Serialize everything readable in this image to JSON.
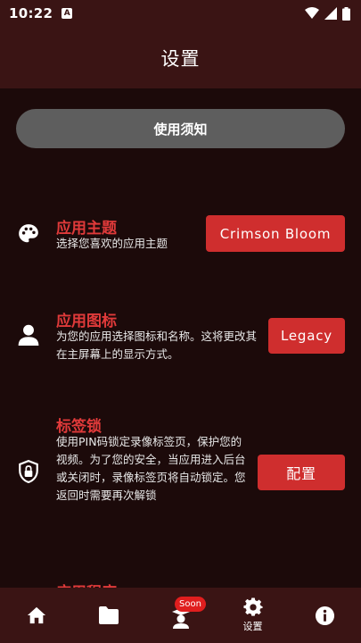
{
  "status": {
    "time": "10:22",
    "badge": "A"
  },
  "appbar": {
    "title": "设置"
  },
  "notice": {
    "label": "使用须知"
  },
  "settings": [
    {
      "title": "应用主题",
      "desc": "选择您喜欢的应用主题",
      "button": "Crimson Bloom",
      "icon": "palette-icon"
    },
    {
      "title": "应用图标",
      "desc": "为您的应用选择图标和名称。这将更改其在主屏幕上的显示方式。",
      "button": "Legacy",
      "icon": "user-icon"
    },
    {
      "title": "标签锁",
      "desc": "使用PIN码锁定录像标签页，保护您的视频。为了您的安全，当应用进入后台或关闭时，录像标签页将自动锁定。您返回时需要再次解锁",
      "button": "配置",
      "icon": "lock-shield-icon"
    },
    {
      "title": "应用程序",
      "icon": "none"
    }
  ],
  "nav": {
    "items": [
      {
        "name": "home",
        "icon": "home-icon"
      },
      {
        "name": "folder",
        "icon": "folder-icon"
      },
      {
        "name": "courses",
        "icon": "graduation-icon",
        "badge": "Soon"
      },
      {
        "name": "settings",
        "icon": "gear-icon",
        "label": "设置"
      },
      {
        "name": "info",
        "icon": "info-icon"
      }
    ]
  },
  "colors": {
    "accent": "#cf2e2e",
    "title_red": "#e03a3a",
    "bar": "#3a1414",
    "bg": "#1c0a0a"
  }
}
